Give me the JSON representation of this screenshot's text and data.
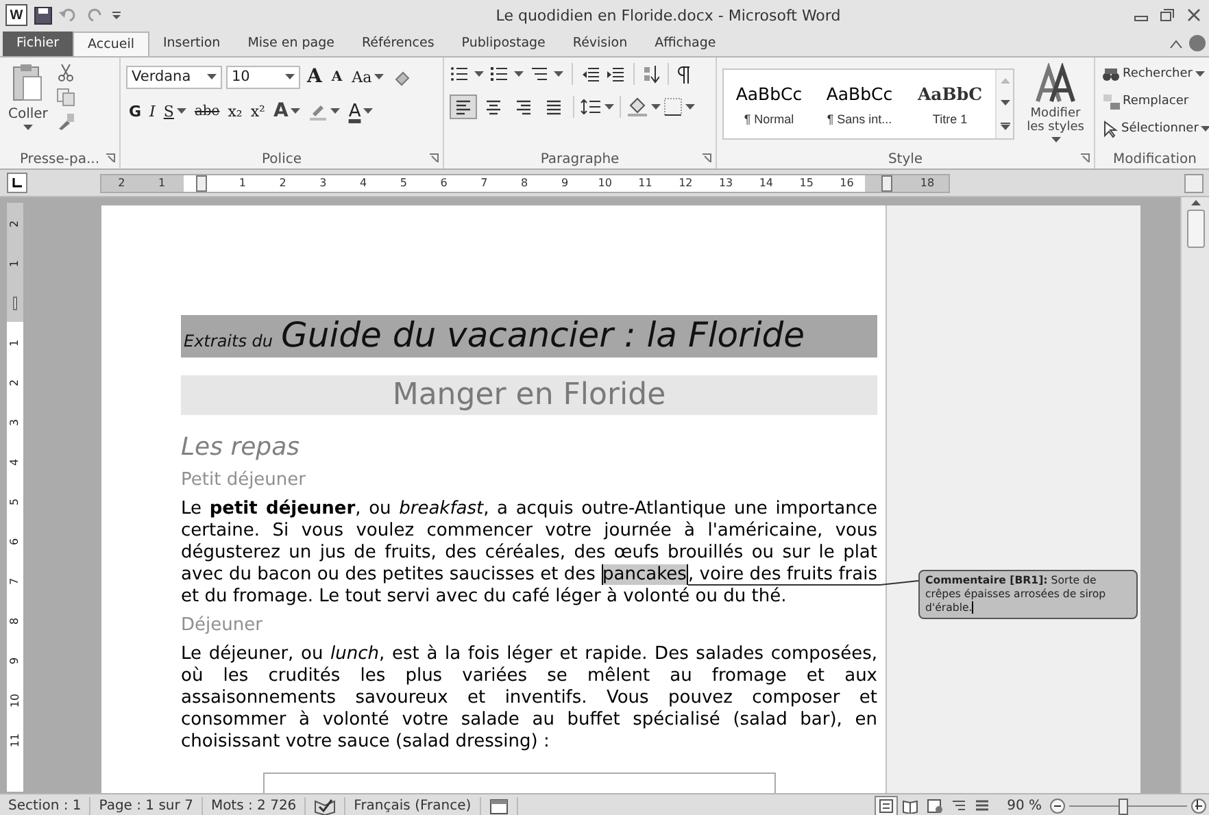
{
  "title_bar": {
    "app_icon": "W",
    "title": "Le quodidien en Floride.docx - Microsoft Word"
  },
  "tabs": [
    {
      "label": "Fichier",
      "kind": "file",
      "selected": false
    },
    {
      "label": "Accueil",
      "kind": "tab",
      "selected": true
    },
    {
      "label": "Insertion",
      "kind": "tab",
      "selected": false
    },
    {
      "label": "Mise en page",
      "kind": "tab",
      "selected": false
    },
    {
      "label": "Références",
      "kind": "tab",
      "selected": false
    },
    {
      "label": "Publipostage",
      "kind": "tab",
      "selected": false
    },
    {
      "label": "Révision",
      "kind": "tab",
      "selected": false
    },
    {
      "label": "Affichage",
      "kind": "tab",
      "selected": false
    }
  ],
  "ribbon": {
    "clipboard": {
      "paste_label": "Coller",
      "group_label": "Presse-pa...",
      "launcher": true
    },
    "font": {
      "font_name": "Verdana",
      "font_size": "10",
      "group_label": "Police",
      "launcher": true,
      "row1": [
        {
          "label": "A",
          "kind": "grow",
          "dropdown": false
        },
        {
          "label": "A",
          "kind": "shrink",
          "dropdown": false
        },
        {
          "label": "Aa",
          "kind": "case",
          "dropdown": true
        },
        {
          "kind": "clear",
          "dropdown": false
        }
      ],
      "row2": [
        {
          "label": "G",
          "kind": "bold",
          "dropdown": false
        },
        {
          "label": "I",
          "kind": "italic",
          "dropdown": false
        },
        {
          "label": "S",
          "kind": "underline",
          "dropdown": true
        },
        {
          "label": "abe",
          "kind": "strike",
          "dropdown": false
        },
        {
          "label": "x₂",
          "kind": "plain",
          "dropdown": false
        },
        {
          "label": "x²",
          "kind": "plain",
          "dropdown": false
        },
        {
          "label": "A",
          "kind": "effects",
          "dropdown": true
        },
        {
          "kind": "highlight",
          "dropdown": true
        },
        {
          "label": "A",
          "kind": "color",
          "dropdown": true
        }
      ]
    },
    "paragraph": {
      "group_label": "Paragraphe",
      "launcher": true,
      "alignments": [
        {
          "kind": "left",
          "selected": true
        },
        {
          "kind": "center",
          "selected": false
        },
        {
          "kind": "right",
          "selected": false
        },
        {
          "kind": "justify",
          "selected": false
        }
      ]
    },
    "styles": {
      "group_label": "Style",
      "launcher": true,
      "change_label": "Modifier les styles",
      "items": [
        {
          "preview": "AaBbCc",
          "name": "¶ Normal",
          "kind": "body"
        },
        {
          "preview": "AaBbCc",
          "name": "¶ Sans int...",
          "kind": "body"
        },
        {
          "preview": "AaBbC",
          "name": "Titre 1",
          "kind": "heading"
        }
      ]
    },
    "editing": {
      "group_label": "Modification",
      "launcher": false,
      "items": [
        {
          "label": "Rechercher",
          "kind": "find",
          "dropdown": true
        },
        {
          "label": "Remplacer",
          "kind": "replace",
          "dropdown": false
        },
        {
          "label": "Sélectionner",
          "kind": "select",
          "dropdown": true
        }
      ]
    }
  },
  "ruler": {
    "horizontal": [
      {
        "kind": "number",
        "label": "2"
      },
      {
        "kind": "number",
        "label": "1"
      },
      {
        "kind": "marker"
      },
      {
        "kind": "number",
        "label": "1"
      },
      {
        "kind": "number",
        "label": "2"
      },
      {
        "kind": "number",
        "label": "3"
      },
      {
        "kind": "number",
        "label": "4"
      },
      {
        "kind": "number",
        "label": "5"
      },
      {
        "kind": "number",
        "label": "6"
      },
      {
        "kind": "number",
        "label": "7"
      },
      {
        "kind": "number",
        "label": "8"
      },
      {
        "kind": "number",
        "label": "9"
      },
      {
        "kind": "number",
        "label": "10"
      },
      {
        "kind": "number",
        "label": "11"
      },
      {
        "kind": "number",
        "label": "12"
      },
      {
        "kind": "number",
        "label": "13"
      },
      {
        "kind": "number",
        "label": "14"
      },
      {
        "kind": "number",
        "label": "15"
      },
      {
        "kind": "number",
        "label": "16"
      },
      {
        "kind": "marker"
      },
      {
        "kind": "number",
        "label": "18"
      }
    ],
    "vertical": [
      {
        "kind": "number",
        "label": "2"
      },
      {
        "kind": "number",
        "label": "1"
      },
      {
        "kind": "marker"
      },
      {
        "kind": "number",
        "label": "1"
      },
      {
        "kind": "number",
        "label": "2"
      },
      {
        "kind": "number",
        "label": "3"
      },
      {
        "kind": "number",
        "label": "4"
      },
      {
        "kind": "number",
        "label": "5"
      },
      {
        "kind": "number",
        "label": "6"
      },
      {
        "kind": "number",
        "label": "7"
      },
      {
        "kind": "number",
        "label": "8"
      },
      {
        "kind": "number",
        "label": "9"
      },
      {
        "kind": "number",
        "label": "10"
      },
      {
        "kind": "number",
        "label": "11"
      }
    ]
  },
  "document": {
    "banner": {
      "prefix": "Extraits du",
      "title": "Guide du vacancier : la Floride"
    },
    "chapter": "Manger en Floride",
    "blocks": [
      {
        "kind": "heading1",
        "text": "Les repas"
      },
      {
        "kind": "heading2",
        "text": "Petit déjeuner"
      },
      {
        "kind": "paragraph",
        "text": "Le **petit déjeuner**, ou *breakfast*, a acquis outre-Atlantique une importance certaine. Si vous voulez commencer votre journée à l'américaine, vous dégusterez un jus de fruits, des céréales, des œufs brouillés ou sur le plat avec du bacon ou des petites saucisses et des ",
        "anchor": "pancakes",
        "text_after": ", voire des fruits frais et du fromage. Le tout servi avec du café léger à volonté ou du thé."
      },
      {
        "kind": "heading2",
        "text": "Déjeuner"
      },
      {
        "kind": "paragraph",
        "text": "Le déjeuner, ou *lunch*, est à la fois léger et rapide. Des salades composées, où les crudités les plus variées se mêlent au fromage et aux assaisonnements savoureux et inventifs. Vous pouvez composer et consommer à volonté votre salade au buffet spécialisé (salad bar), en choisissant votre sauce (salad dressing) :"
      },
      {
        "kind": "table"
      }
    ]
  },
  "comment": {
    "text": "**Commentaire [BR1]:** Sorte de crêpes épaisses arrosées de sirop d'érable."
  },
  "status_bar": {
    "items": [
      {
        "kind": "text",
        "label": "Section : 1"
      },
      {
        "kind": "text",
        "label": "Page : 1 sur 7"
      },
      {
        "kind": "text",
        "label": "Mots : 2 726"
      },
      {
        "kind": "proofing"
      },
      {
        "kind": "text",
        "label": "Français (France)"
      },
      {
        "kind": "macro"
      }
    ],
    "views": [
      {
        "kind": "print",
        "selected": true
      },
      {
        "kind": "reading",
        "selected": false
      },
      {
        "kind": "web",
        "selected": false
      },
      {
        "kind": "outline",
        "selected": false
      },
      {
        "kind": "draft",
        "selected": false
      }
    ],
    "zoom": "90 %",
    "zoom_slider": {
      "level": 0.45
    }
  }
}
